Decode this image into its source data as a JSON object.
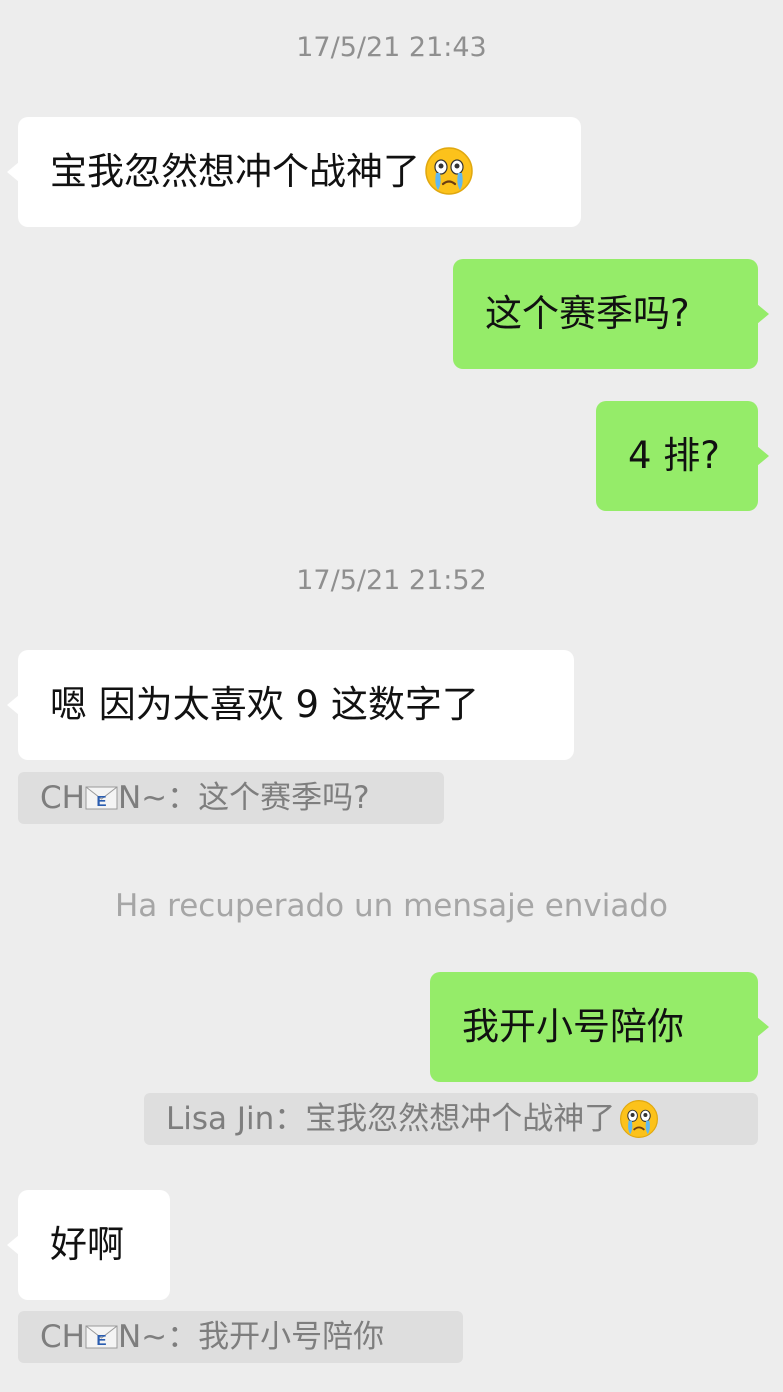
{
  "conversation": {
    "timestamp_1": "17/5/21 21:43",
    "timestamp_2": "17/5/21 21:52",
    "recalled_notice": "Ha recuperado un mensaje enviado",
    "messages": [
      {
        "side": "incoming",
        "text": "宝我忽然想冲个战神了",
        "emoji": "crying-face-emoji"
      },
      {
        "side": "outgoing",
        "text": "这个赛季吗?"
      },
      {
        "side": "outgoing",
        "text": "4 排?"
      },
      {
        "side": "incoming",
        "text": "嗯 因为太喜欢 9 这数字了"
      },
      {
        "side": "outgoing",
        "text": "我开小号陪你"
      },
      {
        "side": "incoming",
        "text": "好啊"
      }
    ],
    "quotes": [
      {
        "name_part_1": "CH",
        "name_icon": "envelope-e-icon",
        "name_part_2": "N~",
        "separator": "：",
        "text": "这个赛季吗?"
      },
      {
        "name": "Lisa Jin",
        "separator": "：",
        "text": "宝我忽然想冲个战神了",
        "emoji": "crying-face-emoji"
      },
      {
        "name_part_1": "CH",
        "name_icon": "envelope-e-icon",
        "name_part_2": "N~",
        "separator": "：",
        "text": "我开小号陪你"
      }
    ]
  },
  "colors": {
    "background": "#ededed",
    "incoming_bubble": "#ffffff",
    "outgoing_bubble": "#95ec69",
    "quote_background": "#dedede",
    "timestamp_text": "#8f8f8f"
  }
}
